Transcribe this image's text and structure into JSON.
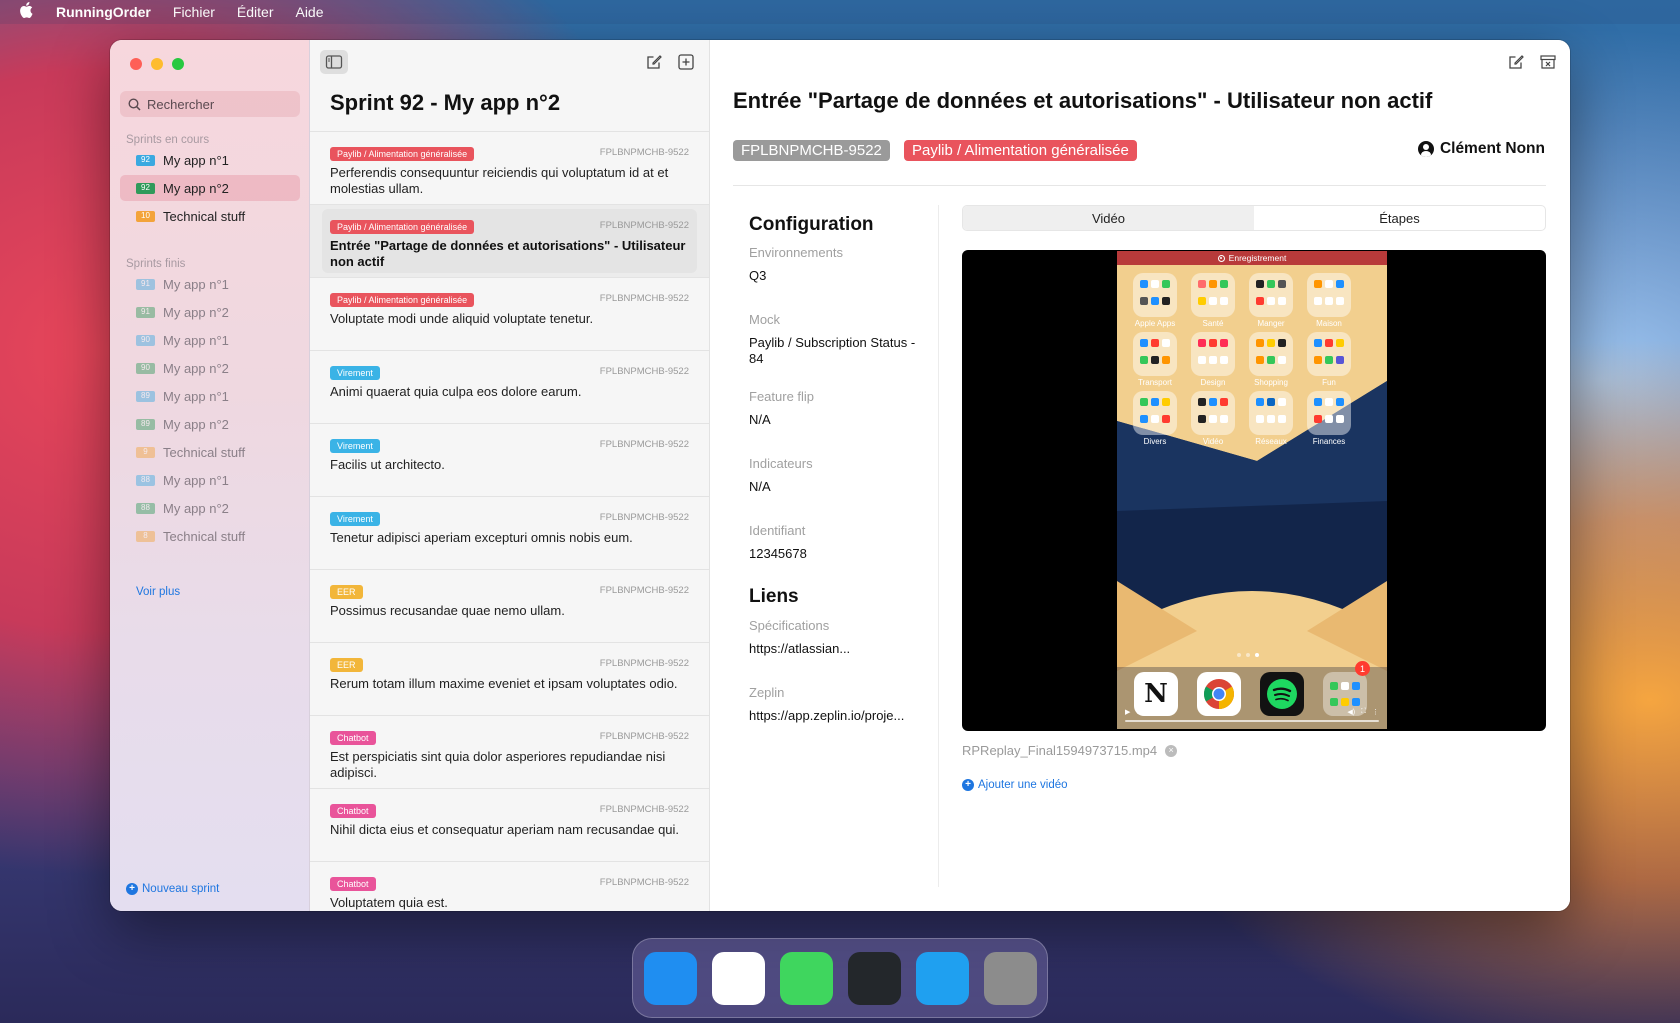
{
  "menubar": {
    "apple_icon": "apple-icon",
    "app_name": "RunningOrder",
    "items": [
      "Fichier",
      "Éditer",
      "Aide"
    ]
  },
  "sidebar": {
    "search_placeholder": "Rechercher",
    "current_section": "Sprints en cours",
    "current": [
      {
        "num": "92",
        "label": "My app n°1",
        "color": "#3aa9e0"
      },
      {
        "num": "92",
        "label": "My app n°2",
        "color": "#2f9a5a",
        "selected": true
      },
      {
        "num": "10",
        "label": "Technical stuff",
        "color": "#f3a33a"
      }
    ],
    "finished_section": "Sprints finis",
    "finished": [
      {
        "num": "91",
        "label": "My app n°1",
        "color": "#3aa9e0"
      },
      {
        "num": "91",
        "label": "My app n°2",
        "color": "#2f9a5a"
      },
      {
        "num": "90",
        "label": "My app n°1",
        "color": "#3aa9e0"
      },
      {
        "num": "90",
        "label": "My app n°2",
        "color": "#2f9a5a"
      },
      {
        "num": "89",
        "label": "My app n°1",
        "color": "#3aa9e0"
      },
      {
        "num": "89",
        "label": "My app n°2",
        "color": "#2f9a5a"
      },
      {
        "num": "9",
        "label": "Technical stuff",
        "color": "#f3a33a"
      },
      {
        "num": "88",
        "label": "My app n°1",
        "color": "#3aa9e0"
      },
      {
        "num": "88",
        "label": "My app n°2",
        "color": "#2f9a5a"
      },
      {
        "num": "8",
        "label": "Technical stuff",
        "color": "#f3a33a"
      }
    ],
    "see_more": "Voir plus",
    "new_sprint": "Nouveau sprint"
  },
  "list": {
    "title": "Sprint 92 - My app n°2",
    "items": [
      {
        "tag": "Paylib / Alimentation généralisée",
        "tag_color": "#e9545d",
        "id": "FPLBNPMCHB-9522",
        "title": "Perferendis consequuntur reiciendis qui voluptatum id at et molestias ullam."
      },
      {
        "tag": "Paylib / Alimentation généralisée",
        "tag_color": "#e9545d",
        "id": "FPLBNPMCHB-9522",
        "title": "Entrée \"Partage de données et autorisations\" - Utilisateur non actif",
        "selected": true
      },
      {
        "tag": "Paylib / Alimentation généralisée",
        "tag_color": "#e9545d",
        "id": "FPLBNPMCHB-9522",
        "title": "Voluptate modi unde aliquid voluptate tenetur."
      },
      {
        "tag": "Virement",
        "tag_color": "#3ab3e6",
        "id": "FPLBNPMCHB-9522",
        "title": "Animi quaerat quia culpa eos dolore earum."
      },
      {
        "tag": "Virement",
        "tag_color": "#3ab3e6",
        "id": "FPLBNPMCHB-9522",
        "title": "Facilis ut architecto."
      },
      {
        "tag": "Virement",
        "tag_color": "#3ab3e6",
        "id": "FPLBNPMCHB-9522",
        "title": "Tenetur adipisci aperiam excepturi omnis nobis eum."
      },
      {
        "tag": "EER",
        "tag_color": "#f2b63a",
        "id": "FPLBNPMCHB-9522",
        "title": "Possimus recusandae quae nemo ullam."
      },
      {
        "tag": "EER",
        "tag_color": "#f2b63a",
        "id": "FPLBNPMCHB-9522",
        "title": "Rerum totam illum maxime eveniet et ipsam voluptates odio."
      },
      {
        "tag": "Chatbot",
        "tag_color": "#e9549a",
        "id": "FPLBNPMCHB-9522",
        "title": "Est perspiciatis sint quia dolor asperiores repudiandae nisi adipisci."
      },
      {
        "tag": "Chatbot",
        "tag_color": "#e9549a",
        "id": "FPLBNPMCHB-9522",
        "title": "Nihil dicta eius et consequatur aperiam nam recusandae qui."
      },
      {
        "tag": "Chatbot",
        "tag_color": "#e9549a",
        "id": "FPLBNPMCHB-9522",
        "title": "Voluptatem quia est."
      }
    ]
  },
  "detail": {
    "title": "Entrée \"Partage de données et autorisations\" - Utilisateur non actif",
    "ticket_id": "FPLBNPMCHB-9522",
    "epic": "Paylib / Alimentation généralisée",
    "assignee": "Clément Nonn",
    "config": {
      "heading": "Configuration",
      "fields": [
        {
          "label": "Environnements",
          "value": "Q3"
        },
        {
          "label": "Mock",
          "value": "Paylib / Subscription Status - 84"
        },
        {
          "label": "Feature flip",
          "value": "N/A"
        },
        {
          "label": "Indicateurs",
          "value": "N/A"
        },
        {
          "label": "Identifiant",
          "value": "12345678"
        }
      ]
    },
    "links": {
      "heading": "Liens",
      "fields": [
        {
          "label": "Spécifications",
          "value": "https://atlassian..."
        },
        {
          "label": "Zeplin",
          "value": "https://app.zeplin.io/proje..."
        }
      ]
    },
    "tabs": [
      "Vidéo",
      "Étapes"
    ],
    "video": {
      "recording_label": "Enregistrement",
      "folders": [
        "Apple Apps",
        "Santé",
        "Manger",
        "Maison",
        "Transport",
        "Design",
        "Shopping",
        "Fun",
        "Divers",
        "Vidéo",
        "Réseaux",
        "Finances"
      ],
      "dock_badge": "1",
      "time": "0:00 / 0:02"
    },
    "filename": "RPReplay_Final1594973715.mp4",
    "add_video": "Ajouter une vidéo"
  },
  "dock": [
    {
      "name": "finder",
      "color": "#1f8ef1"
    },
    {
      "name": "white-app",
      "color": "#ffffff"
    },
    {
      "name": "green-app",
      "color": "#3fd65e"
    },
    {
      "name": "dark-app",
      "color": "#23272b"
    },
    {
      "name": "blue-app",
      "color": "#1fa0f0"
    },
    {
      "name": "gray-app",
      "color": "#8c8c8c"
    }
  ]
}
